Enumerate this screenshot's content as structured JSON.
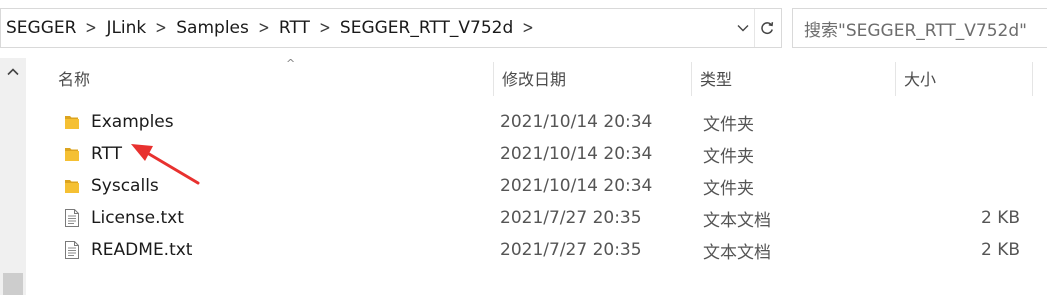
{
  "breadcrumbs": [
    "SEGGER",
    "JLink",
    "Samples",
    "RTT",
    "SEGGER_RTT_V752d"
  ],
  "search": {
    "placeholder": "搜索\"SEGGER_RTT_V752d\""
  },
  "columns": {
    "name": "名称",
    "date": "修改日期",
    "type": "类型",
    "size": "大小"
  },
  "files": [
    {
      "name": "Examples",
      "date": "2021/10/14 20:34",
      "type": "文件夹",
      "size": "",
      "icon": "folder-icon"
    },
    {
      "name": "RTT",
      "date": "2021/10/14 20:34",
      "type": "文件夹",
      "size": "",
      "icon": "folder-icon"
    },
    {
      "name": "Syscalls",
      "date": "2021/10/14 20:34",
      "type": "文件夹",
      "size": "",
      "icon": "folder-icon"
    },
    {
      "name": "License.txt",
      "date": "2021/7/27 20:35",
      "type": "文本文档",
      "size": "2 KB",
      "icon": "text-file-icon"
    },
    {
      "name": "README.txt",
      "date": "2021/7/27 20:35",
      "type": "文本文档",
      "size": "2 KB",
      "icon": "text-file-icon"
    }
  ],
  "colors": {
    "folder": "#f5c033",
    "folder_dark": "#dca41f",
    "annotation_arrow": "#e8312f"
  }
}
